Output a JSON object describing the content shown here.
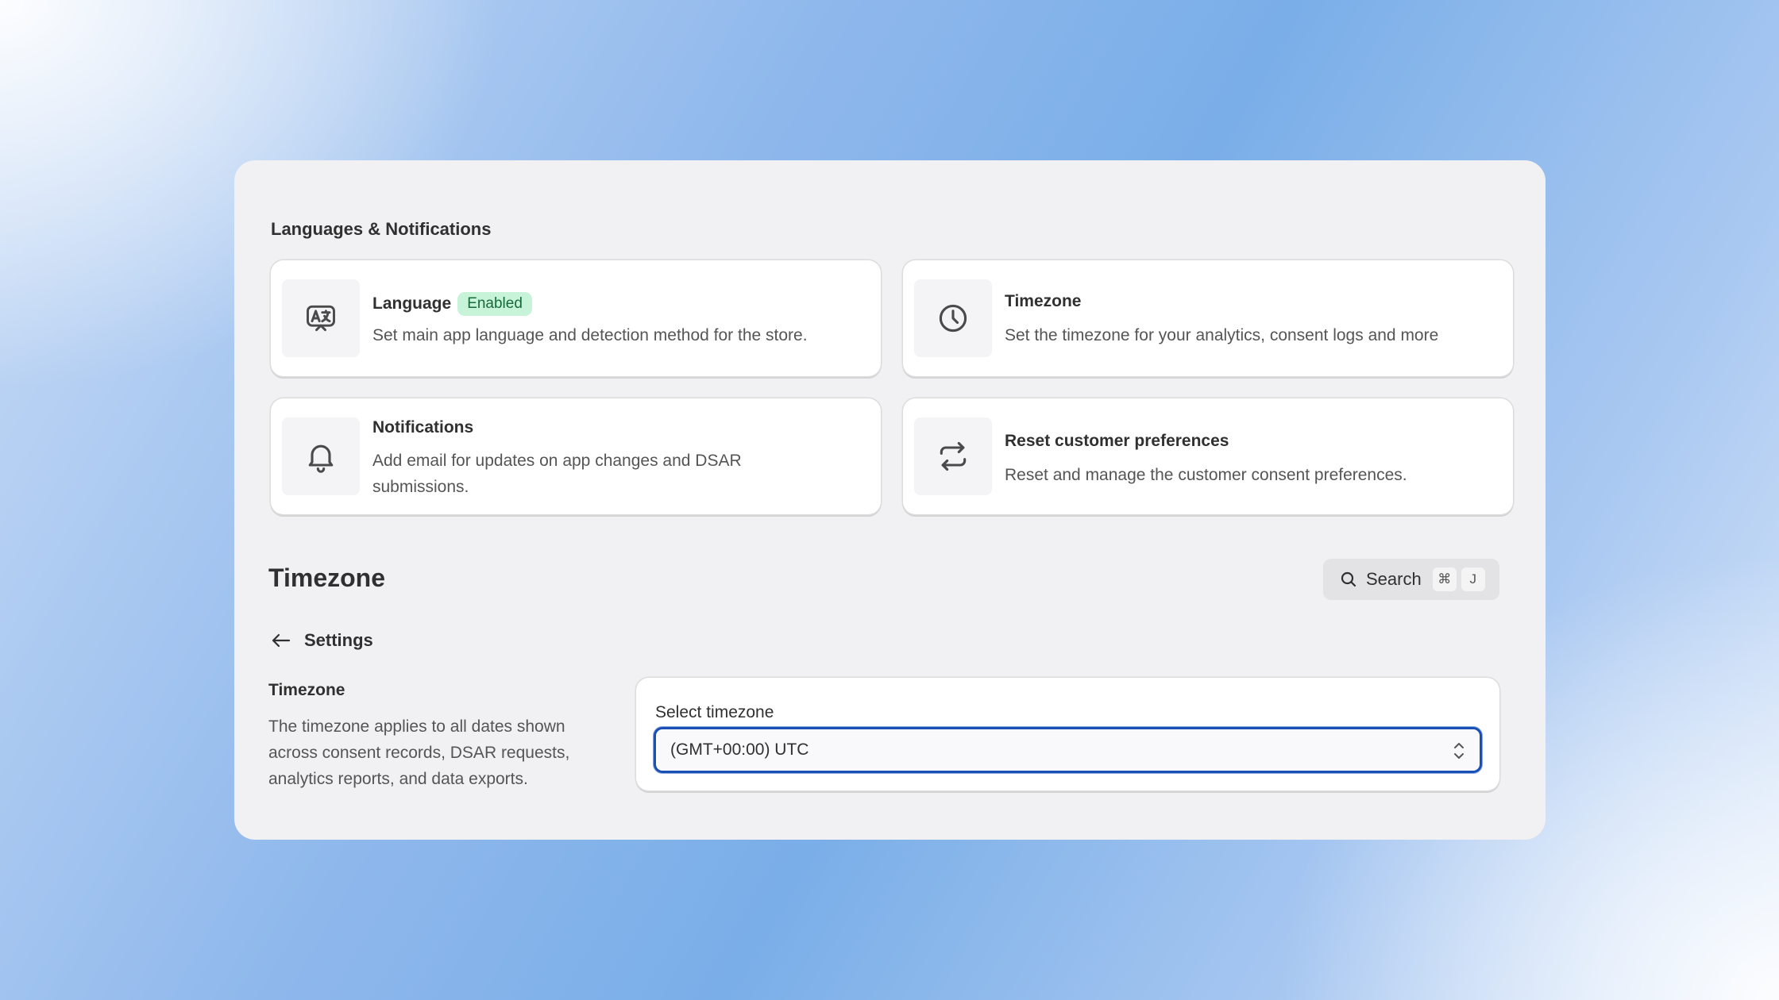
{
  "section_title": "Languages & Notifications",
  "cards": [
    {
      "title": "Language",
      "badge": "Enabled",
      "desc": "Set main app language and detection method for the store.",
      "icon": "translate-icon"
    },
    {
      "title": "Timezone",
      "desc": "Set the timezone for your analytics, consent logs and more",
      "icon": "clock-icon"
    },
    {
      "title": "Notifications",
      "desc": "Add email for updates on app changes and DSAR submissions.",
      "icon": "bell-icon"
    },
    {
      "title": "Reset customer preferences",
      "desc": "Reset and manage the customer consent preferences.",
      "icon": "refresh-icon"
    }
  ],
  "page_title": "Timezone",
  "search": {
    "label": "Search",
    "shortcut_key1": "⌘",
    "shortcut_key2": "J"
  },
  "back": {
    "label": "Settings"
  },
  "timezone_section": {
    "heading": "Timezone",
    "desc": "The timezone applies to all dates shown across consent records, DSAR requests, analytics reports, and data exports.",
    "select_label": "Select timezone",
    "selected_value": "(GMT+00:00) UTC"
  },
  "colors": {
    "accent": "#1a4fb5",
    "badge_bg": "#c7f4d8",
    "badge_text": "#176b3a",
    "annotation_arrow": "#1d43c0"
  }
}
